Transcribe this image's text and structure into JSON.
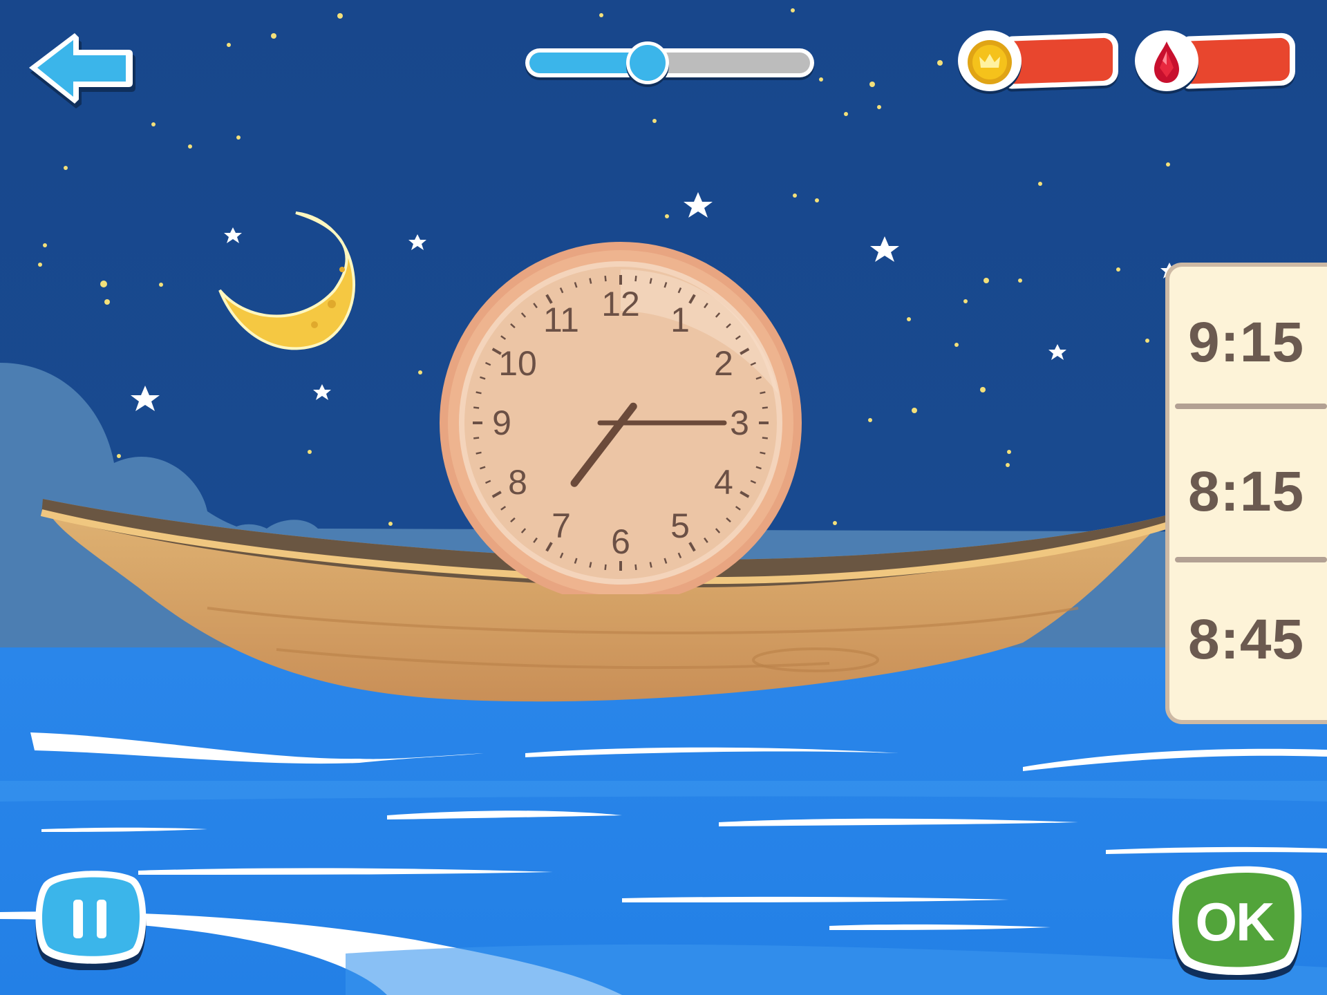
{
  "game": {
    "progress": 0.42,
    "coins": {
      "icon": "crown-coin-icon",
      "value": ""
    },
    "gems": {
      "icon": "ruby-gem-icon",
      "value": ""
    }
  },
  "clock": {
    "numbers": [
      "12",
      "1",
      "2",
      "3",
      "4",
      "5",
      "6",
      "7",
      "8",
      "9",
      "10",
      "11"
    ],
    "time": {
      "hour": 7,
      "minute": 15
    }
  },
  "answers": [
    {
      "label": "9:15"
    },
    {
      "label": "8:15"
    },
    {
      "label": "8:45"
    }
  ],
  "buttons": {
    "back": {
      "icon": "back-arrow-icon"
    },
    "pause": {
      "icon": "pause-icon"
    },
    "ok": {
      "label": "OK"
    }
  },
  "colors": {
    "sky": "#194a8c",
    "sea": "#2785e8",
    "accent_blue": "#3bb5ea",
    "ok_green": "#52a43a",
    "counter_red": "#e8462e",
    "panel_bg": "#fdf3d8"
  }
}
